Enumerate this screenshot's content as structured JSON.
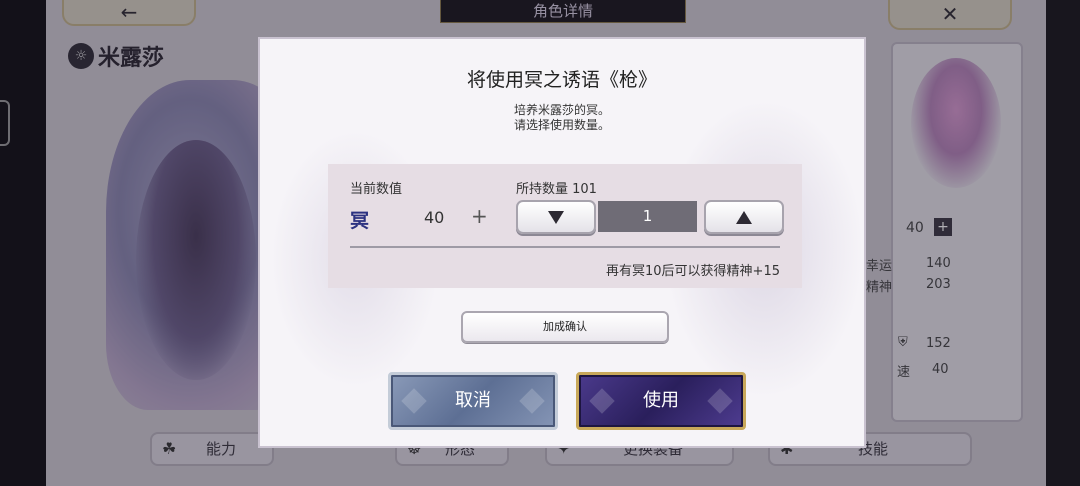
{
  "background": {
    "header_title": "角色详情",
    "back_icon": "back-arrow-icon",
    "close_icon": "close-x-icon",
    "character_name": "米露莎",
    "right_panel": {
      "level": "40",
      "stats": [
        {
          "label": "幸运",
          "value": "140"
        },
        {
          "label": "精神",
          "value": "203"
        },
        {
          "label": "",
          "value": "152"
        },
        {
          "label": "速",
          "value": "40"
        }
      ]
    },
    "tabs": [
      {
        "label": "能力"
      },
      {
        "label": "形态"
      },
      {
        "label": "更换装备"
      },
      {
        "label": "技能"
      }
    ]
  },
  "dialog": {
    "title": "将使用冥之诱语《枪》",
    "description_line1": "培养米露莎的冥。",
    "description_line2": "请选择使用数量。",
    "current_value_label": "当前数值",
    "owned_label": "所持数量 101",
    "item_icon_text": "冥",
    "current_value": "40",
    "plus": "+",
    "quantity": "1",
    "bonus_note": "再有冥10后可以获得精神+15",
    "confirm_label": "加成确认",
    "cancel_label": "取消",
    "use_label": "使用"
  }
}
